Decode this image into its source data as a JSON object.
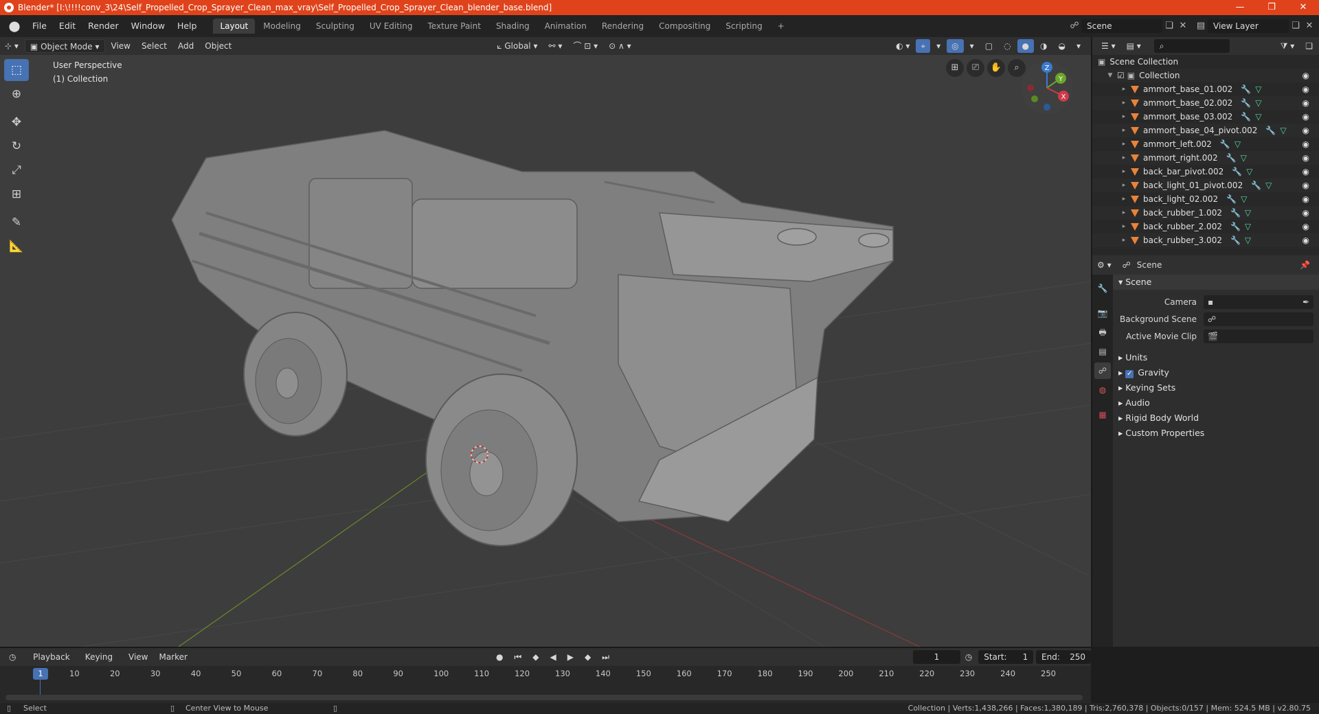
{
  "window": {
    "title": "Blender* [I:\\!!!!conv_3\\24\\Self_Propelled_Crop_Sprayer_Clean_max_vray\\Self_Propelled_Crop_Sprayer_Clean_blender_base.blend]",
    "minimize": "—",
    "maximize": "❐",
    "close": "✕"
  },
  "menubar": {
    "items": [
      "File",
      "Edit",
      "Render",
      "Window",
      "Help"
    ],
    "workspaces": [
      "Layout",
      "Modeling",
      "Sculpting",
      "UV Editing",
      "Texture Paint",
      "Shading",
      "Animation",
      "Rendering",
      "Compositing",
      "Scripting"
    ],
    "add_tab": "+",
    "scene": "Scene",
    "view_layer": "View Layer"
  },
  "viewport_header": {
    "mode": "Object Mode",
    "menus": [
      "View",
      "Select",
      "Add",
      "Object"
    ],
    "orientation": "Global"
  },
  "viewport": {
    "perspective": "User Perspective",
    "collection": "(1) Collection",
    "gizmo_labels": {
      "z": "Z",
      "y": "Y",
      "x": "X"
    }
  },
  "outliner": {
    "scene_collection": "Scene Collection",
    "collection": "Collection",
    "objects": [
      "ammort_base_01.002",
      "ammort_base_02.002",
      "ammort_base_03.002",
      "ammort_base_04_pivot.002",
      "ammort_left.002",
      "ammort_right.002",
      "back_bar_pivot.002",
      "back_light_01_pivot.002",
      "back_light_02.002",
      "back_rubber_1.002",
      "back_rubber_2.002",
      "back_rubber_3.002"
    ]
  },
  "properties": {
    "header_title": "Scene",
    "section_scene": "Scene",
    "camera_label": "Camera",
    "background_scene_label": "Background Scene",
    "active_movie_clip_label": "Active Movie Clip",
    "units": "Units",
    "gravity": "Gravity",
    "gravity_checked": true,
    "keying_sets": "Keying Sets",
    "audio": "Audio",
    "rigid_body_world": "Rigid Body World",
    "custom_properties": "Custom Properties"
  },
  "timeline": {
    "menus": [
      "Playback",
      "Keying",
      "View",
      "Marker"
    ],
    "current_frame": "1",
    "start_label": "Start:",
    "start": "1",
    "end_label": "End:",
    "end": "250",
    "ticks": [
      "1",
      "10",
      "20",
      "30",
      "40",
      "50",
      "60",
      "70",
      "80",
      "90",
      "100",
      "110",
      "120",
      "130",
      "140",
      "150",
      "160",
      "170",
      "180",
      "190",
      "200",
      "210",
      "220",
      "230",
      "240",
      "250"
    ]
  },
  "statusbar": {
    "left": "Select",
    "middle": "Center View to Mouse",
    "right": "Collection | Verts:1,438,266 | Faces:1,380,189 | Tris:2,760,378 | Objects:0/157 | Mem: 524.5 MB | v2.80.75"
  },
  "colors": {
    "title_bar": "#e0431b",
    "accent": "#4772b3",
    "viewport_bg": "#3d3d3d",
    "mesh_icon": "#e8833a"
  }
}
